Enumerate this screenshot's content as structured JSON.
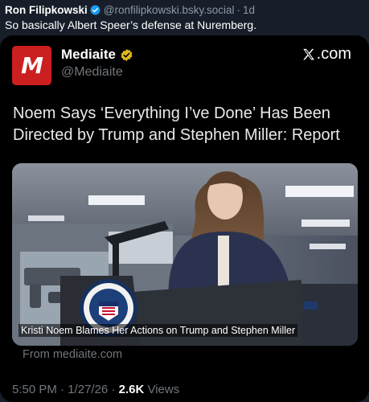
{
  "post": {
    "author_name": "Ron Filipkowski",
    "author_handle": "@ronfilipkowski.bsky.social",
    "separator": "·",
    "age": "1d",
    "text": "So basically Albert Speer’s defense at Nuremberg."
  },
  "embed": {
    "logo_letter": "M",
    "publisher_name": "Mediaite",
    "publisher_handle": "@Mediaite",
    "platform_label": ".com",
    "headline": "Noem Says ‘Everything I’ve Done’ Has Been Directed by Trump and Stephen Miller: Report",
    "image_caption": "Kristi Noem Blames Her Actions on Trump and Stephen Miller",
    "source": "From mediaite.com",
    "time": "5:50 PM",
    "date": "1/27/26",
    "views_count": "2.6K",
    "views_label": "Views",
    "meta_separator": "·"
  },
  "colors": {
    "page_background": "#171e29",
    "card_background": "#000000",
    "logo_red": "#cc1f1f",
    "verified_blue": "#1d9bf0",
    "gold_badge": "#e2b719",
    "muted_text": "#71767b"
  },
  "icons": [
    "verified-badge-icon",
    "gold-verified-badge-icon",
    "x-logo-icon",
    "mediaite-logo-icon"
  ]
}
